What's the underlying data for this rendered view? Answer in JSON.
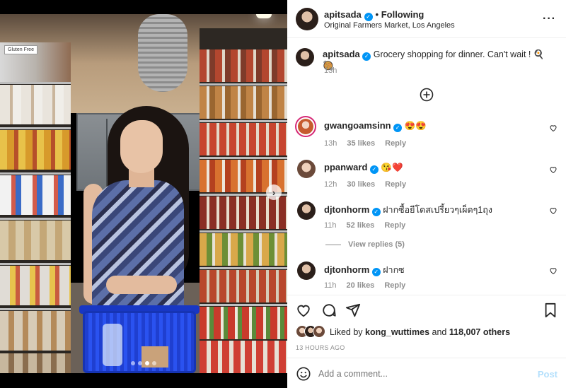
{
  "post": {
    "author": "apitsada",
    "follow_status": "Following",
    "location": "Original Farmers Market, Los Angeles",
    "caption": "Grocery shopping for dinner. Can't wait ! 🍳 🥘",
    "caption_time": "13h"
  },
  "comments": [
    {
      "user": "gwangoamsinn",
      "text": "😍😍",
      "time": "13h",
      "likes": "35 likes",
      "reply": "Reply"
    },
    {
      "user": "ppanward",
      "text": "😘❤️",
      "time": "12h",
      "likes": "30 likes",
      "reply": "Reply"
    },
    {
      "user": "djtonhorm",
      "text": "ฝากซื้อยีโดสเปรี้ยวๆเผ็ดๆ1ถุง",
      "time": "11h",
      "likes": "52 likes",
      "reply": "Reply",
      "view_replies": "View replies (5)"
    },
    {
      "user": "djtonhorm",
      "text": "ฝากซ",
      "time": "11h",
      "likes": "20 likes",
      "reply": "Reply"
    }
  ],
  "likes": {
    "prefix": "Liked by",
    "user": "kong_wuttimes",
    "joiner": "and",
    "others": "118,007 others"
  },
  "timestamp": "13 HOURS AGO",
  "comment_box": {
    "placeholder": "Add a comment...",
    "post_label": "Post"
  },
  "photo": {
    "carousel_index": 3,
    "carousel_count": 4,
    "sign_text": "Gluten Free"
  },
  "colors": {
    "verified": "#0095f6",
    "post_button": "#b2dffc",
    "link_muted": "#8e8e8e"
  }
}
